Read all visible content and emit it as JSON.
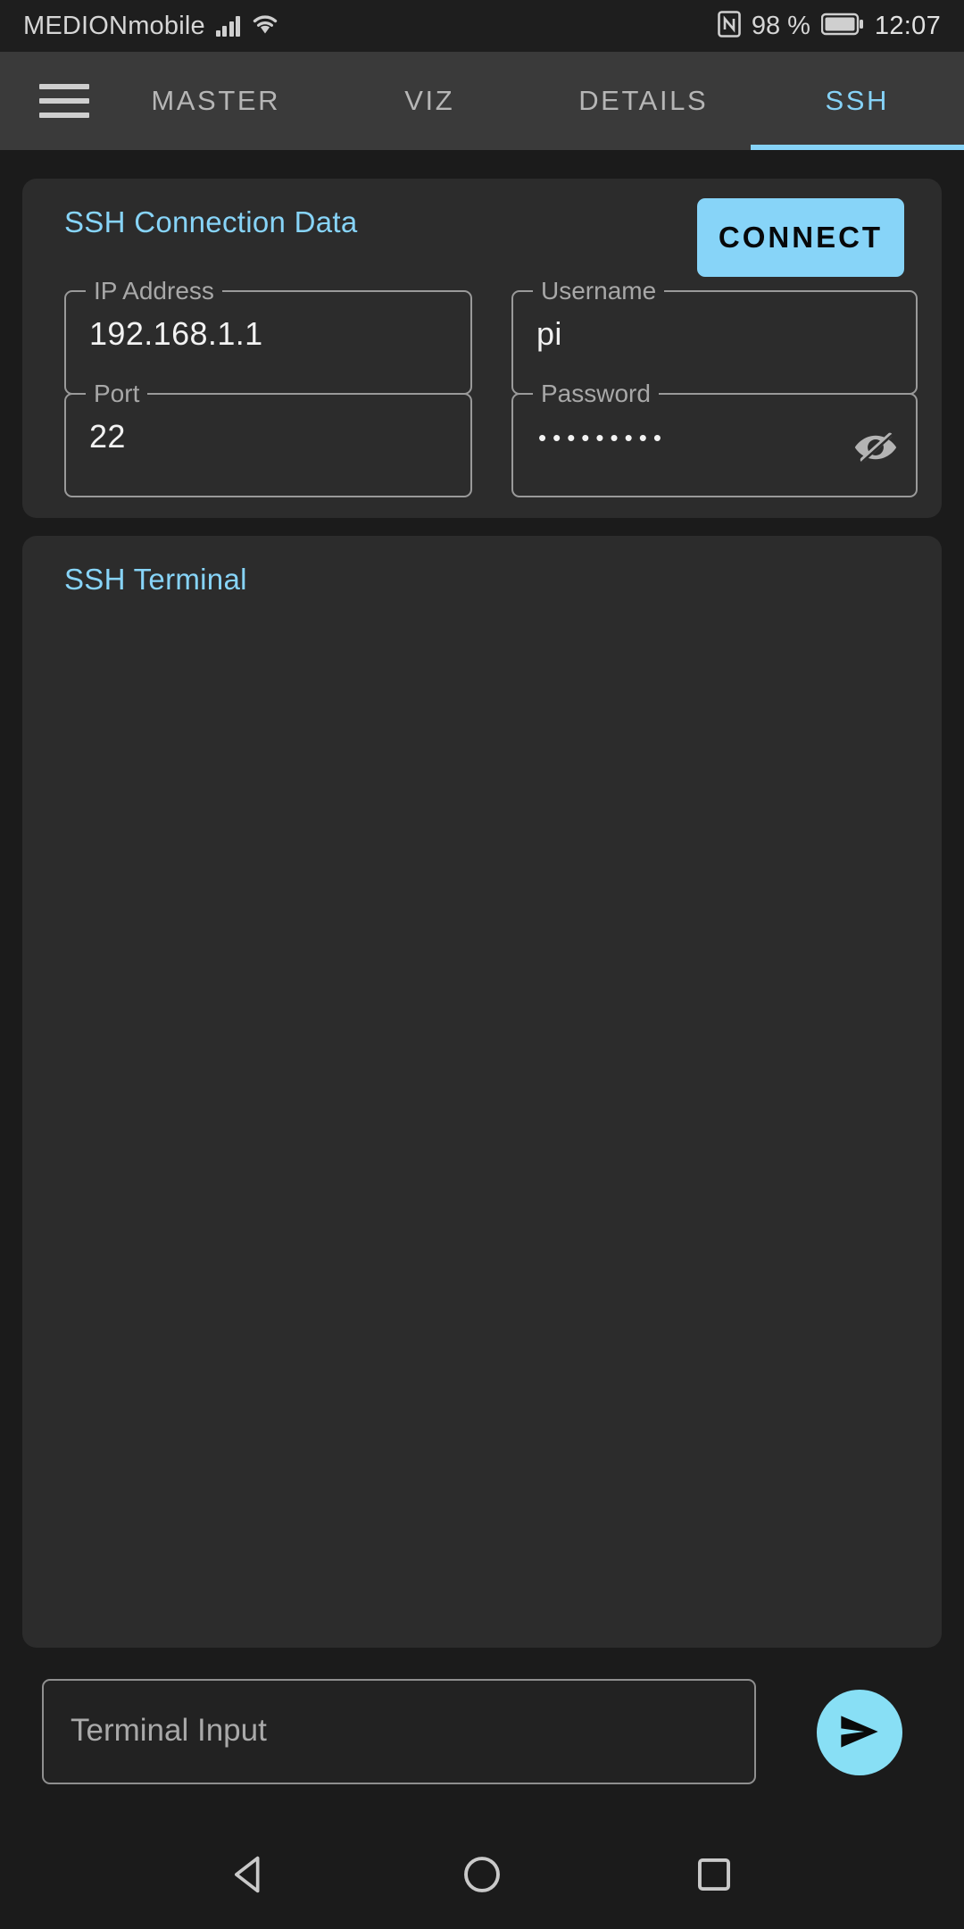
{
  "statusbar": {
    "carrier": "MEDIONmobile",
    "signal_icon": "signal-bars-icon",
    "wifi_icon": "wifi-icon",
    "nfc_icon": "nfc-icon",
    "battery_percent": "98 %",
    "battery_icon": "battery-full-icon",
    "clock": "12:07"
  },
  "appbar": {
    "menu_icon": "hamburger-menu-icon",
    "tabs": [
      {
        "label": "MASTER",
        "active": false
      },
      {
        "label": "VIZ",
        "active": false
      },
      {
        "label": "DETAILS",
        "active": false
      },
      {
        "label": "SSH",
        "active": true
      }
    ],
    "active_tab": "SSH"
  },
  "connection_card": {
    "title": "SSH Connection Data",
    "connect_label": "CONNECT",
    "fields": [
      {
        "label": "IP Address",
        "value": "192.168.1.1"
      },
      {
        "label": "Username",
        "value": "pi"
      },
      {
        "label": "Port",
        "value": "22"
      },
      {
        "label": "Password",
        "value": "•••••••••",
        "masked": true,
        "toggle_icon": "eye-off-icon"
      }
    ]
  },
  "terminal_card": {
    "title": "SSH Terminal",
    "output": ""
  },
  "input_row": {
    "placeholder": "Terminal Input",
    "value": "",
    "send_icon": "send-arrow-icon"
  },
  "navbar": {
    "back_icon": "back-triangle-icon",
    "home_icon": "home-circle-icon",
    "recents_icon": "recents-square-icon"
  },
  "colors": {
    "accent": "#87d4f8",
    "page_bg": "#1b1b1b",
    "card_bg": "#2c2c2c",
    "appbar_bg": "#3a3a3a",
    "field_border": "#9a9a9a",
    "text_primary": "#f2f2f2",
    "text_secondary": "#a8a8a8"
  }
}
